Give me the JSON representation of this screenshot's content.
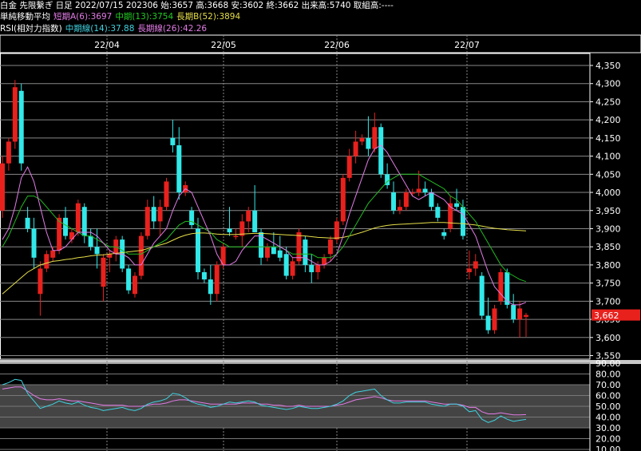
{
  "header": {
    "line1": "白金 先限繫ぎ 日足 2022/07/15 202306 始:3657 高:3668 安:3602 終:3662 出来高:5740 取組高:----",
    "ma_title": "単純移動平均",
    "ma_short": "短期A(6):3697",
    "ma_mid": "中期(13):3754",
    "ma_long": "長期B(52):3894",
    "rsi_title": "RSI(相対力指数)",
    "rsi_mid": "中期線(14):37.88",
    "rsi_long": "長期線(26):42.26"
  },
  "colors": {
    "up": "#e8211d",
    "down": "#32e8e8",
    "ma_short": "#e27be6",
    "ma_mid": "#22bb22",
    "ma_long": "#e6df4a",
    "rsi_mid": "#3fd2e0",
    "rsi_long": "#e27be6",
    "price_label_bg": "#e8211d"
  },
  "chart_data": [
    {
      "type": "candlestick",
      "x_labels": [
        "22/04",
        "22/05",
        "22/06",
        "22/07"
      ],
      "y_ticks": [
        "4,350",
        "4,300",
        "4,250",
        "4,200",
        "4,150",
        "4,100",
        "4,050",
        "4,000",
        "3,950",
        "3,900",
        "3,850",
        "3,800",
        "3,750",
        "3,700",
        "3,650",
        "3,600",
        "3,550"
      ],
      "ylim": [
        3530,
        4370
      ],
      "current_price_label": "3,662",
      "current_price": 3662,
      "candles": [
        [
          3950,
          4100,
          3930,
          4080
        ],
        [
          4080,
          4150,
          4060,
          4140
        ],
        [
          4140,
          4310,
          4120,
          4290
        ],
        [
          4280,
          4300,
          4060,
          4080
        ],
        [
          3930,
          3960,
          3890,
          3900
        ],
        [
          3900,
          3930,
          3790,
          3820
        ],
        [
          3720,
          3810,
          3660,
          3790
        ],
        [
          3790,
          3840,
          3780,
          3830
        ],
        [
          3820,
          3850,
          3810,
          3840
        ],
        [
          3840,
          3940,
          3830,
          3930
        ],
        [
          3930,
          3960,
          3870,
          3880
        ],
        [
          3870,
          3900,
          3860,
          3890
        ],
        [
          3890,
          3980,
          3880,
          3970
        ],
        [
          3960,
          3970,
          3860,
          3880
        ],
        [
          3880,
          3900,
          3840,
          3850
        ],
        [
          3850,
          3900,
          3790,
          3830
        ],
        [
          3740,
          3830,
          3700,
          3820
        ],
        [
          3820,
          3840,
          3780,
          3830
        ],
        [
          3830,
          3880,
          3810,
          3870
        ],
        [
          3870,
          3880,
          3780,
          3790
        ],
        [
          3790,
          3800,
          3720,
          3730
        ],
        [
          3720,
          3780,
          3710,
          3770
        ],
        [
          3770,
          3890,
          3760,
          3880
        ],
        [
          3880,
          3980,
          3870,
          3960
        ],
        [
          3960,
          3990,
          3900,
          3920
        ],
        [
          3920,
          3980,
          3880,
          3960
        ],
        [
          3960,
          4040,
          3950,
          4030
        ],
        [
          4150,
          4200,
          4110,
          4130
        ],
        [
          4130,
          4180,
          3980,
          4000
        ],
        [
          4000,
          4030,
          3990,
          4020
        ],
        [
          3950,
          3960,
          3900,
          3910
        ],
        [
          3900,
          3930,
          3760,
          3780
        ],
        [
          3780,
          3790,
          3750,
          3760
        ],
        [
          3760,
          3800,
          3690,
          3720
        ],
        [
          3720,
          3810,
          3700,
          3800
        ],
        [
          3800,
          3860,
          3790,
          3850
        ],
        [
          3900,
          3960,
          3880,
          3890
        ],
        [
          3880,
          3900,
          3870,
          3880
        ],
        [
          3880,
          3940,
          3850,
          3920
        ],
        [
          3920,
          3960,
          3890,
          3950
        ],
        [
          3950,
          4020,
          3930,
          3890
        ],
        [
          3890,
          3900,
          3800,
          3820
        ],
        [
          3820,
          3860,
          3810,
          3850
        ],
        [
          3850,
          3890,
          3830,
          3830
        ],
        [
          3840,
          3880,
          3810,
          3820
        ],
        [
          3830,
          3850,
          3760,
          3770
        ],
        [
          3770,
          3820,
          3760,
          3810
        ],
        [
          3810,
          3900,
          3800,
          3890
        ],
        [
          3870,
          3880,
          3780,
          3800
        ],
        [
          3800,
          3830,
          3750,
          3780
        ],
        [
          3780,
          3810,
          3760,
          3800
        ],
        [
          3800,
          3830,
          3790,
          3820
        ],
        [
          3830,
          3880,
          3810,
          3870
        ],
        [
          3870,
          3930,
          3860,
          3920
        ],
        [
          3920,
          4050,
          3910,
          4040
        ],
        [
          4040,
          4120,
          4030,
          4100
        ],
        [
          4100,
          4170,
          4080,
          4140
        ],
        [
          4140,
          4160,
          4130,
          4150
        ],
        [
          4150,
          4210,
          4100,
          4120
        ],
        [
          4120,
          4220,
          4110,
          4180
        ],
        [
          4180,
          4190,
          4040,
          4050
        ],
        [
          4050,
          4080,
          4010,
          4020
        ],
        [
          4000,
          4030,
          3940,
          3950
        ],
        [
          3950,
          3980,
          3940,
          3960
        ],
        [
          3960,
          4010,
          3950,
          4000
        ],
        [
          4000,
          4010,
          3990,
          4000
        ],
        [
          4000,
          4060,
          3990,
          4010
        ],
        [
          4010,
          4030,
          3990,
          4000
        ],
        [
          4000,
          4010,
          3950,
          3960
        ],
        [
          3960,
          3970,
          3920,
          3930
        ],
        [
          3890,
          3900,
          3870,
          3880
        ],
        [
          3900,
          3990,
          3890,
          3970
        ],
        [
          3970,
          4010,
          3950,
          3960
        ],
        [
          3960,
          3980,
          3870,
          3880
        ],
        [
          3780,
          3840,
          3760,
          3790
        ],
        [
          3790,
          3830,
          3770,
          3810
        ],
        [
          3770,
          3780,
          3650,
          3660
        ],
        [
          3660,
          3710,
          3610,
          3620
        ],
        [
          3620,
          3690,
          3610,
          3680
        ],
        [
          3700,
          3790,
          3690,
          3780
        ],
        [
          3780,
          3790,
          3680,
          3690
        ],
        [
          3690,
          3720,
          3640,
          3650
        ],
        [
          3650,
          3700,
          3600,
          3680
        ],
        [
          3657,
          3668,
          3602,
          3662
        ]
      ],
      "ma_short": [
        3870,
        3900,
        3960,
        4040,
        4070,
        4030,
        3960,
        3890,
        3840,
        3840,
        3850,
        3870,
        3890,
        3890,
        3890,
        3880,
        3860,
        3840,
        3830,
        3830,
        3820,
        3800,
        3800,
        3830,
        3860,
        3880,
        3900,
        3950,
        3990,
        4010,
        4000,
        3960,
        3920,
        3880,
        3830,
        3800,
        3800,
        3810,
        3840,
        3860,
        3880,
        3880,
        3870,
        3860,
        3850,
        3840,
        3820,
        3820,
        3820,
        3810,
        3800,
        3800,
        3810,
        3830,
        3880,
        3940,
        3990,
        4040,
        4090,
        4120,
        4130,
        4110,
        4080,
        4050,
        4020,
        3990,
        3980,
        3990,
        4000,
        3990,
        3980,
        3960,
        3950,
        3940,
        3910,
        3880,
        3830,
        3780,
        3740,
        3720,
        3700,
        3690,
        3690,
        3697
      ],
      "ma_mid": [
        3850,
        3880,
        3920,
        3960,
        3990,
        3990,
        3980,
        3960,
        3940,
        3920,
        3910,
        3900,
        3890,
        3880,
        3880,
        3870,
        3860,
        3850,
        3850,
        3840,
        3830,
        3830,
        3830,
        3840,
        3850,
        3860,
        3870,
        3890,
        3910,
        3920,
        3920,
        3910,
        3900,
        3890,
        3870,
        3860,
        3850,
        3850,
        3850,
        3850,
        3850,
        3850,
        3850,
        3850,
        3850,
        3840,
        3830,
        3830,
        3830,
        3830,
        3820,
        3820,
        3820,
        3830,
        3850,
        3880,
        3910,
        3940,
        3970,
        3990,
        4010,
        4030,
        4040,
        4050,
        4050,
        4050,
        4050,
        4040,
        4030,
        4020,
        4010,
        3990,
        3980,
        3960,
        3940,
        3920,
        3890,
        3860,
        3830,
        3800,
        3780,
        3770,
        3760,
        3754
      ],
      "ma_long": [
        3720,
        3735,
        3750,
        3765,
        3780,
        3790,
        3800,
        3805,
        3810,
        3812,
        3815,
        3817,
        3820,
        3822,
        3825,
        3827,
        3828,
        3830,
        3832,
        3834,
        3836,
        3838,
        3840,
        3845,
        3850,
        3855,
        3860,
        3868,
        3876,
        3882,
        3886,
        3888,
        3888,
        3887,
        3885,
        3884,
        3884,
        3884,
        3885,
        3886,
        3887,
        3887,
        3886,
        3885,
        3884,
        3883,
        3882,
        3881,
        3880,
        3878,
        3876,
        3875,
        3874,
        3874,
        3876,
        3880,
        3885,
        3890,
        3896,
        3902,
        3906,
        3909,
        3911,
        3912,
        3913,
        3914,
        3915,
        3916,
        3917,
        3917,
        3917,
        3916,
        3915,
        3914,
        3912,
        3910,
        3907,
        3904,
        3901,
        3899,
        3897,
        3896,
        3895,
        3894
      ],
      "candle_style": "red up / cyan down"
    },
    {
      "type": "line",
      "name": "RSI",
      "y_ticks": [
        "90.00",
        "80.00",
        "70.00",
        "60.00",
        "50.00",
        "40.00",
        "30.00",
        "20.00",
        "10.00"
      ],
      "ylim": [
        5,
        93
      ],
      "bands": [
        [
          30,
          70
        ]
      ],
      "rsi_mid": [
        70,
        72,
        75,
        74,
        62,
        55,
        48,
        50,
        52,
        55,
        53,
        52,
        54,
        51,
        49,
        48,
        46,
        47,
        48,
        49,
        47,
        46,
        48,
        52,
        54,
        55,
        57,
        62,
        61,
        58,
        54,
        52,
        51,
        49,
        50,
        52,
        54,
        53,
        54,
        55,
        54,
        51,
        50,
        49,
        48,
        47,
        48,
        50,
        49,
        48,
        48,
        49,
        50,
        52,
        55,
        60,
        63,
        64,
        65,
        66,
        60,
        56,
        53,
        53,
        54,
        54,
        54,
        54,
        52,
        51,
        50,
        52,
        52,
        50,
        45,
        46,
        38,
        35,
        37,
        41,
        38,
        36,
        37,
        37.88
      ],
      "rsi_long": [
        66,
        67,
        68,
        68,
        64,
        60,
        57,
        56,
        56,
        57,
        56,
        55,
        55,
        54,
        53,
        52,
        51,
        51,
        51,
        51,
        50,
        50,
        50,
        51,
        52,
        52,
        53,
        55,
        56,
        56,
        55,
        54,
        53,
        52,
        52,
        52,
        52,
        52,
        53,
        53,
        53,
        52,
        52,
        51,
        51,
        50,
        50,
        51,
        50,
        50,
        50,
        50,
        50,
        51,
        52,
        54,
        56,
        57,
        58,
        59,
        58,
        56,
        55,
        55,
        55,
        55,
        55,
        55,
        54,
        53,
        52,
        52,
        52,
        51,
        49,
        49,
        45,
        43,
        43,
        44,
        43,
        42,
        42,
        42.26
      ]
    }
  ]
}
